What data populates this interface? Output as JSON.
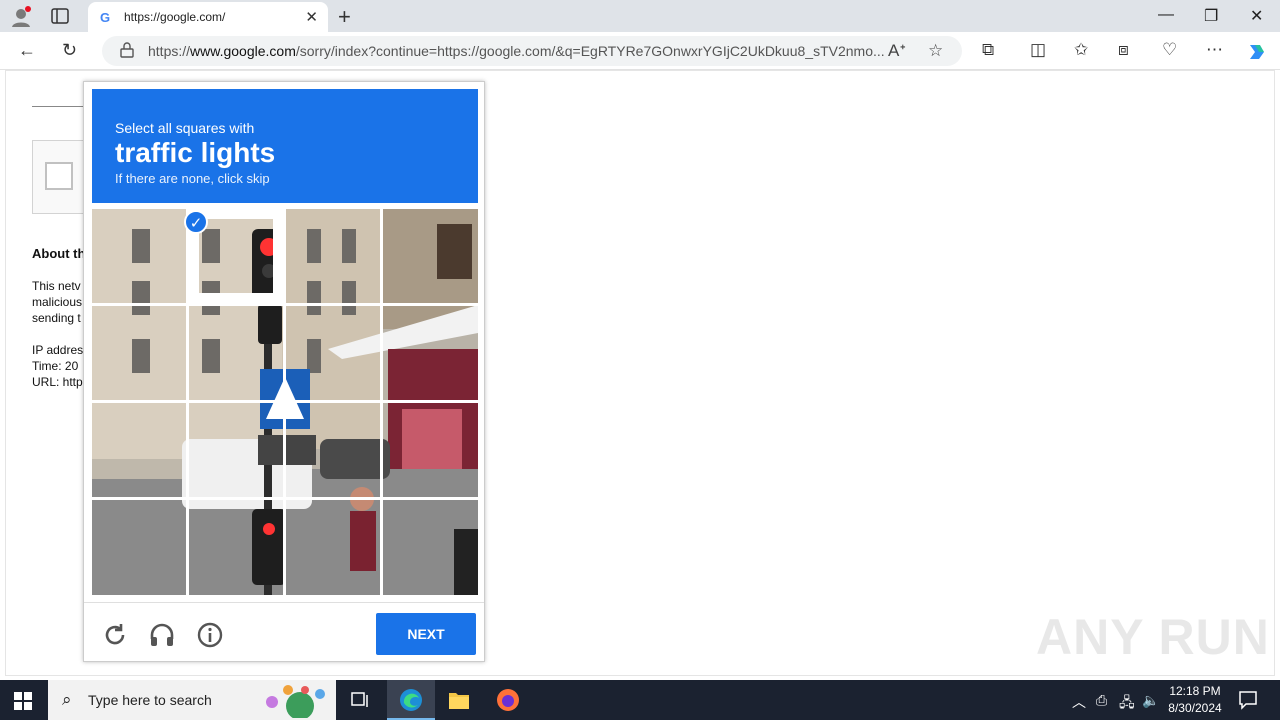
{
  "browser": {
    "tab_title": "https://google.com/",
    "url_prefix": "https://",
    "url_host": "www.google.com",
    "url_rest": "/sorry/index?continue=https://google.com/&q=EgRTYRe7GOnwxrYGIjC2UkDkuu8_sTV2nmo..."
  },
  "background_page": {
    "about_heading": "About th",
    "text_lines": [
      "This netv",
      "malicious",
      "sending t",
      "",
      "IP addres",
      "Time: 20",
      "URL: http"
    ]
  },
  "captcha": {
    "instruction_line1": "Select all squares with",
    "instruction_target": "traffic lights",
    "instruction_line3": "If there are none, click skip",
    "selected_tiles": [
      1
    ],
    "next_label": "NEXT",
    "accent_color": "#1a73e8"
  },
  "watermark": "ANY RUN",
  "taskbar": {
    "search_placeholder": "Type here to search",
    "time": "12:18 PM",
    "date": "8/30/2024"
  }
}
